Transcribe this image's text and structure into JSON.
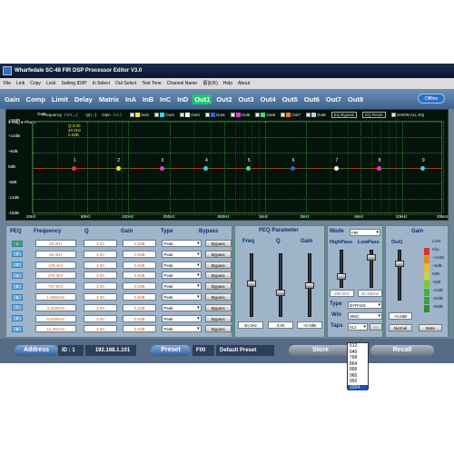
{
  "window": {
    "title": "Wharfedale SC-48 FIR DSP Processor Editor V3.0"
  },
  "menu": [
    "File",
    "Link",
    "Copy",
    "Lock",
    "Setting ID/IP",
    "In Select",
    "Out Select",
    "Test Tone",
    "Channel Name",
    "语言(K)",
    "Help",
    "About"
  ],
  "tabs": [
    "Gain",
    "Comp",
    "Limit",
    "Delay",
    "Matrix",
    "InA",
    "InB",
    "InC",
    "InD",
    "Out1",
    "Out2",
    "Out3",
    "Out4",
    "Out5",
    "Out6",
    "Out7",
    "Out8"
  ],
  "active_tab": "Out1",
  "status_button": "Offline",
  "graph": {
    "channels": [
      {
        "label": "Out1",
        "color": "#f2e33a"
      },
      {
        "label": "Out2",
        "color": "#39d4e6"
      },
      {
        "label": "Out3",
        "color": "#ffffff"
      },
      {
        "label": "Out4",
        "color": "#2f5fd8"
      },
      {
        "label": "Out5",
        "color": "#e23bd0"
      },
      {
        "label": "Out6",
        "color": "#39e27a"
      },
      {
        "label": "Out7",
        "color": "#f07a2a"
      },
      {
        "label": "Out8",
        "color": "#c8c8c8"
      }
    ],
    "frequency_label": "Frequency（+/-/→）",
    "q_label": "Q(+,-)",
    "gain_label": "Gain（↑/↓）",
    "eq_bypass": "EQ Bypass",
    "eq_reset": "EQ Reset",
    "show_all": "SHOW ALL EQ",
    "mag": "Mag",
    "phase": "Phase",
    "active_point_info": [
      "Q:3.00",
      "40.3Hz",
      "0.0dB"
    ],
    "point_labels": [
      "1",
      "2",
      "3",
      "4",
      "5",
      "6",
      "7",
      "8",
      "9"
    ],
    "point_colors": [
      "#e53a3a",
      "#f2e33a",
      "#e23bd0",
      "#39d4e6",
      "#39e27a",
      "#2f5fd8",
      "#ffffff",
      "#e23bd0",
      "#39d4e6"
    ]
  },
  "chart_data": {
    "type": "line",
    "title": "",
    "xlabel": "",
    "ylabel": "",
    "x_ticks": [
      "20Hz",
      "50Hz",
      "100Hz",
      "200Hz",
      "500Hz",
      "1kHz",
      "2kHz",
      "5kHz",
      "10kHz",
      "20kHz"
    ],
    "y_ticks": [
      "+18dB",
      "+12dB",
      "+6dB",
      "0dB",
      "-6dB",
      "-12dB",
      "-18dB"
    ],
    "ylim": [
      -18,
      18
    ],
    "series": [
      {
        "x": [
          "20Hz",
          "20kHz"
        ],
        "values": [
          0,
          0
        ]
      }
    ],
    "peq_points": [
      {
        "id": "1",
        "freq_hz": 40.3,
        "gain_db": 0
      },
      {
        "id": "2",
        "freq_hz": 84.4,
        "gain_db": 0
      },
      {
        "id": "3",
        "freq_hz": 176.4,
        "gain_db": 0
      },
      {
        "id": "4",
        "freq_hz": 370.3,
        "gain_db": 0
      },
      {
        "id": "5",
        "freq_hz": 757.9,
        "gain_db": 0
      },
      {
        "id": "6",
        "freq_hz": 1598,
        "gain_db": 0
      },
      {
        "id": "7",
        "freq_hz": 3323,
        "gain_db": 0
      },
      {
        "id": "8",
        "freq_hz": 6818,
        "gain_db": 0
      },
      {
        "id": "9",
        "freq_hz": 14253,
        "gain_db": 0
      }
    ]
  },
  "peq_table": {
    "headers": [
      "PEQ",
      "Frequency",
      "Q",
      "Gain",
      "Type",
      "Bypass"
    ],
    "rows": [
      {
        "n": "1",
        "freq": "40.3Hz",
        "q": "3.00",
        "gain": "0.0dB",
        "type": "Peak",
        "bypass": "Bypass"
      },
      {
        "n": "2",
        "freq": "84.4Hz",
        "q": "3.00",
        "gain": "0.0dB",
        "type": "Peak",
        "bypass": "Bypass"
      },
      {
        "n": "3",
        "freq": "176.4Hz",
        "q": "3.00",
        "gain": "0.0dB",
        "type": "Peak",
        "bypass": "Bypass"
      },
      {
        "n": "4",
        "freq": "370.3Hz",
        "q": "3.00",
        "gain": "0.0dB",
        "type": "Peak",
        "bypass": "Bypass"
      },
      {
        "n": "5",
        "freq": "757.9Hz",
        "q": "3.00",
        "gain": "0.0dB",
        "type": "Peak",
        "bypass": "Bypass"
      },
      {
        "n": "6",
        "freq": "1.598KHz",
        "q": "3.00",
        "gain": "0.0dB",
        "type": "Peak",
        "bypass": "Bypass"
      },
      {
        "n": "7",
        "freq": "3.323KHz",
        "q": "3.00",
        "gain": "0.0dB",
        "type": "Peak",
        "bypass": "Bypass"
      },
      {
        "n": "8",
        "freq": "6.818KHz",
        "q": "3.00",
        "gain": "0.0dB",
        "type": "Peak",
        "bypass": "Bypass"
      },
      {
        "n": "9",
        "freq": "14.25KHz",
        "q": "3.00",
        "gain": "0.0dB",
        "type": "Peak",
        "bypass": "Bypass"
      }
    ]
  },
  "peq_param": {
    "title": "PEQ Parameter",
    "freq": "Freq",
    "q": "Q",
    "gain": "Gain",
    "freq_val": "40.3Hz",
    "q_val": "3.00",
    "gain_val": "+0.0dB"
  },
  "mode": {
    "label": "Mode",
    "value": "FIR",
    "highpass": "HighPass",
    "lowpass": "LowPass",
    "hp_val": "250.0Hz",
    "lp_val": "20.16KHz",
    "type_label": "Type",
    "type_val": "BYPASS",
    "win_label": "Win",
    "win_val": "SINC",
    "taps_label": "Taps",
    "taps_val": "512",
    "ok": "OK"
  },
  "gain_panel": {
    "title": "Gain",
    "channel": "Out1",
    "value": "+0.0dB",
    "normal": "Normal",
    "mute": "Mute",
    "limit": [
      "Limit",
      "Clip",
      "+12dB",
      "+6dB",
      "0dB",
      "-5dB",
      "-10dB",
      "-20dB",
      "-30dB"
    ]
  },
  "bottom": {
    "address": "Address",
    "id": "ID : 1",
    "ip": "192.168.1.101",
    "preset": "Preset",
    "preset_num": "F00",
    "preset_name": "Default Preset",
    "store": "Store",
    "recall": "Recall"
  },
  "taps_options": [
    "512",
    "640",
    "768",
    "864",
    "896",
    "960",
    "992",
    "1024"
  ],
  "taps_selected": "1024"
}
